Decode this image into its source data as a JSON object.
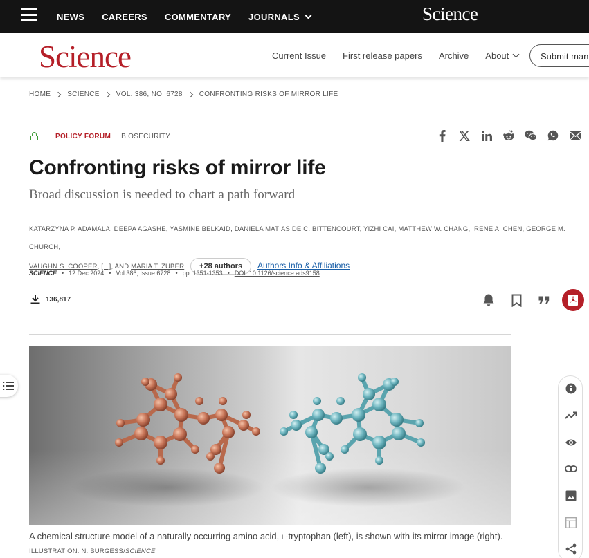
{
  "topbar": {
    "nav": [
      "NEWS",
      "CAREERS",
      "COMMENTARY",
      "JOURNALS"
    ],
    "logo": "Science"
  },
  "header": {
    "brand": "Science",
    "nav": [
      "Current Issue",
      "First release papers",
      "Archive",
      "About"
    ],
    "submit": "Submit manuscript"
  },
  "breadcrumb": [
    "HOME",
    "SCIENCE",
    "VOL. 386, NO. 6728",
    "CONFRONTING RISKS OF MIRROR LIFE"
  ],
  "tags": {
    "section": "POLICY FORUM",
    "topic": "BIOSECURITY"
  },
  "share_icons": [
    "facebook-icon",
    "x-icon",
    "linkedin-icon",
    "reddit-icon",
    "wechat-icon",
    "whatsapp-icon",
    "email-icon"
  ],
  "article": {
    "title": "Confronting risks of mirror life",
    "subtitle": "Broad discussion is needed to chart a path forward",
    "authors": [
      "KATARZYNA P. ADAMALA",
      "DEEPA AGASHE",
      "YASMINE BELKAID",
      "DANIELA MATIAS DE C. BITTENCOURT",
      "YIZHI CAI",
      "MATTHEW W. CHANG",
      "IRENE A. CHEN",
      "GEORGE M. CHURCH",
      "VAUGHN S. COOPER"
    ],
    "authors_ellipsis": "[...]",
    "authors_and": ", AND",
    "last_author": "MARIA T. ZUBER",
    "more_authors": "+28 authors",
    "affiliations_link": "Authors Info & Affiliations"
  },
  "meta": {
    "journal": "SCIENCE",
    "date": "12 Dec 2024",
    "volume": "Vol 386, Issue 6728",
    "pages": "pp. 1351-1353",
    "doi": "DOI: 10.1126/science.ads9158"
  },
  "stats": {
    "downloads": "136,817"
  },
  "action_icons": [
    "bell-icon",
    "bookmark-icon",
    "quote-icon",
    "pdf-icon"
  ],
  "figure": {
    "caption_before": "A chemical structure model of a naturally occurring amino acid, ",
    "caption_l": "L",
    "caption_after": "-tryptophan (left), is shown with its mirror image (right).",
    "credit_prefix": "ILLUSTRATION: N. BURGESS/",
    "credit_source": "SCIENCE"
  },
  "rail_icons": [
    "info-icon",
    "trending-icon",
    "eye-icon",
    "link-icon",
    "image-icon",
    "table-icon",
    "share-icon"
  ],
  "colors": {
    "brand_red": "#b51f28",
    "topbar": "#141414",
    "link_blue": "#1a5fa8",
    "molecule_left": "#c9775a",
    "molecule_right": "#6fb6c0"
  }
}
